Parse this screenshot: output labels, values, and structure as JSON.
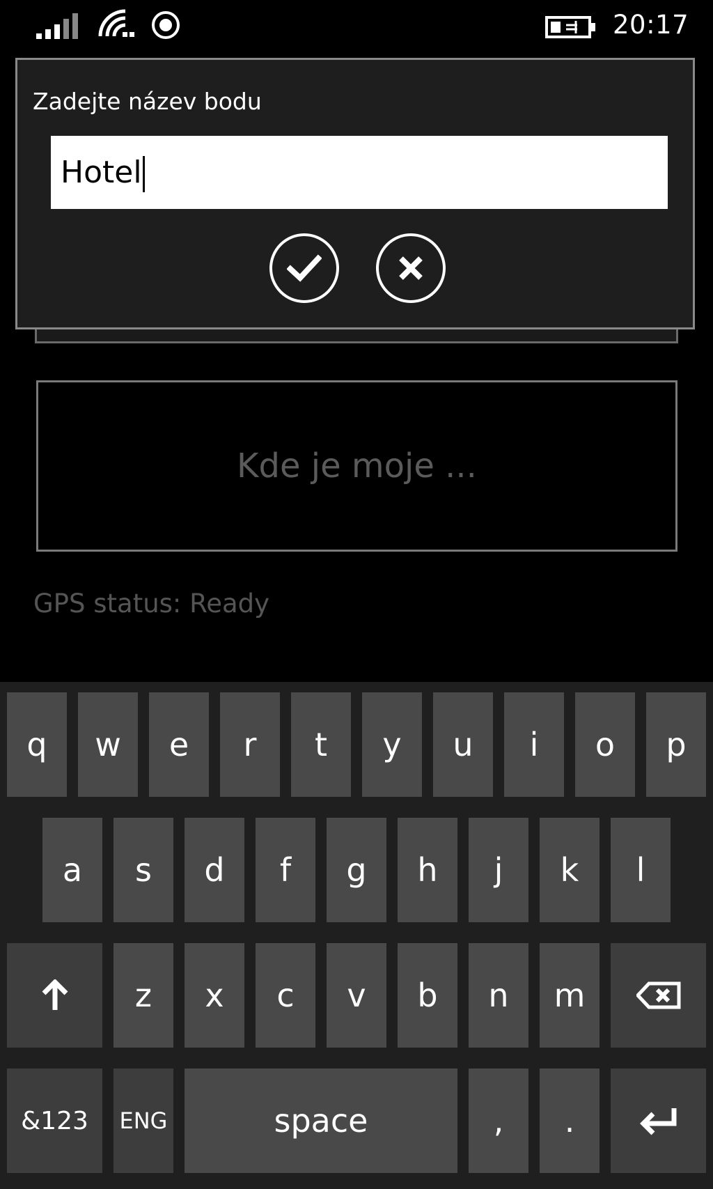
{
  "status_bar": {
    "clock": "20:17",
    "icons": [
      "signal-icon",
      "wifi-icon",
      "location-icon",
      "battery-charging-icon"
    ]
  },
  "dialog": {
    "title": "Zadejte název bodu",
    "input_value": "Hotel",
    "confirm_icon": "check-icon",
    "cancel_icon": "close-icon"
  },
  "main": {
    "where_button_label": "Kde je moje ...",
    "gps_status": "GPS status: Ready"
  },
  "keyboard": {
    "row1": [
      "q",
      "w",
      "e",
      "r",
      "t",
      "y",
      "u",
      "i",
      "o",
      "p"
    ],
    "row2": [
      "a",
      "s",
      "d",
      "f",
      "g",
      "h",
      "j",
      "k",
      "l"
    ],
    "row3": [
      "z",
      "x",
      "c",
      "v",
      "b",
      "n",
      "m"
    ],
    "symbols_key": "&123",
    "language_key": "ENG",
    "space_key": "space",
    "comma_key": ",",
    "period_key": ".",
    "shift_icon": "shift-arrow-icon",
    "backspace_icon": "backspace-icon",
    "enter_icon": "enter-icon"
  },
  "colors": {
    "background": "#000000",
    "dialog_background": "#1e1e1e",
    "key_background": "#494949",
    "muted_text": "#5b5b5b"
  }
}
